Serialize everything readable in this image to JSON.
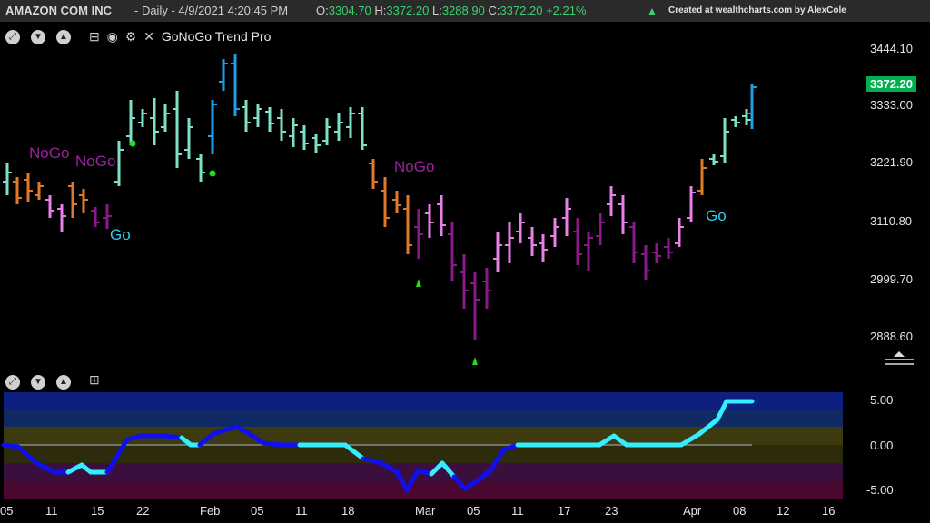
{
  "header": {
    "symbol": "AMAZON COM INC",
    "meta": "- Daily - 4/9/2021 4:20:45 PM",
    "ohlc_o_label": "O:",
    "ohlc_o": "3304.70",
    "ohlc_h_label": "H:",
    "ohlc_h": "3372.20",
    "ohlc_l_label": "L:",
    "ohlc_l": "3288.90",
    "ohlc_c_label": "C:",
    "ohlc_c": "3372.20",
    "change": "+2.21%",
    "arrow_icon": "triangle-up-icon",
    "credit": "Created at wealthcharts.com by AlexCole"
  },
  "indicator": {
    "name": "GoNoGo Trend Pro",
    "buttons": [
      "expand-icon",
      "collapse-icon",
      "chevron-up-icon"
    ],
    "legend_icons": [
      "minimize-icon",
      "eye-icon",
      "gear-icon",
      "close-icon"
    ]
  },
  "price_axis": {
    "labels": [
      "3444.10",
      "3333.00",
      "3221.90",
      "3110.80",
      "2999.70",
      "2888.60"
    ],
    "last_price": "3372.20",
    "last_price_color": "#00b050"
  },
  "osc_axis": {
    "labels": [
      "5.00",
      "0.00",
      "-5.00"
    ]
  },
  "lower_panel": {
    "add_icon": "plus-square-icon"
  },
  "x_axis": {
    "labels": [
      "05",
      "11",
      "15",
      "22",
      "Feb",
      "05",
      "11",
      "18",
      "Mar",
      "05",
      "11",
      "17",
      "23",
      "Apr",
      "08",
      "12",
      "16"
    ]
  },
  "annotations": [
    {
      "text": "NoGo",
      "color": "#a020a0"
    },
    {
      "text": "NoGo",
      "color": "#a020a0"
    },
    {
      "text": "Go",
      "color": "#33ccee"
    },
    {
      "text": "NoGo",
      "color": "#a020a0"
    },
    {
      "text": "Go",
      "color": "#33ccee"
    }
  ],
  "colors": {
    "go_strong": "#1e9fe8",
    "go_weak": "#7fe0c8",
    "nogo_strong": "#8a1a8a",
    "nogo_weak": "#e880e8",
    "nogo_orange": "#e07a2a",
    "osc_line_pos": "#33eeff",
    "osc_line_neg": "#1010ee"
  }
}
